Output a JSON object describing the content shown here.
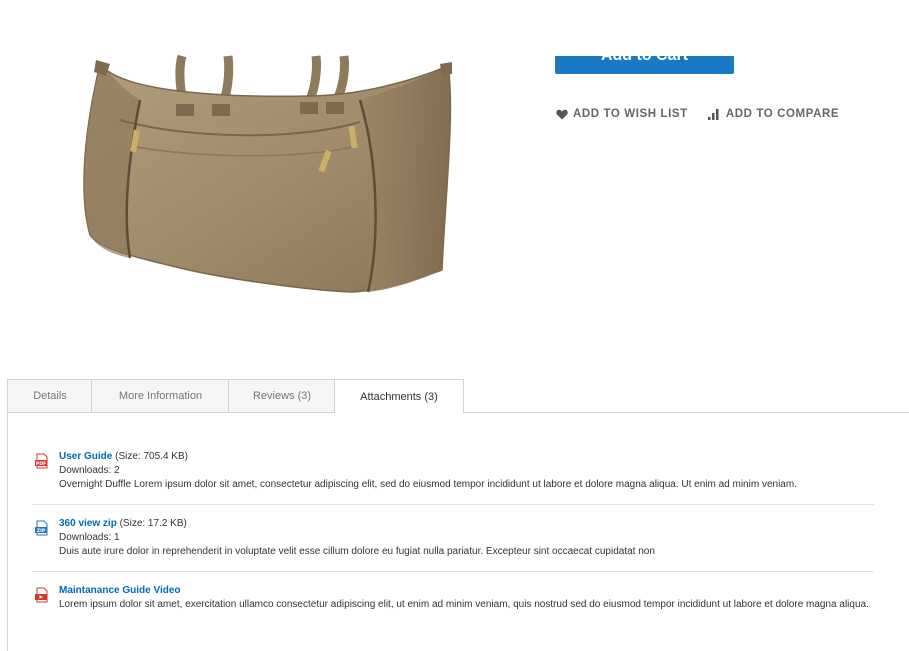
{
  "product": {
    "image_alt": "Overnight Duffle",
    "add_to_cart_label": "Add to Cart",
    "wish_list_label": "ADD TO WISH LIST",
    "compare_label": "ADD TO COMPARE"
  },
  "tabs": [
    {
      "label": "Details",
      "active": false
    },
    {
      "label": "More Information",
      "active": false
    },
    {
      "label": "Reviews (3)",
      "active": false
    },
    {
      "label": "Attachments (3)",
      "active": true
    }
  ],
  "attachments": [
    {
      "icon": "pdf-file-icon",
      "title": "User Guide",
      "size": "(Size: 705.4 KB)",
      "downloads": "Downloads: 2",
      "description": "Overnight Duffle Lorem ipsum dolor sit amet, consectetur adipiscing elit, sed do eiusmod tempor incididunt ut labore et dolore magna aliqua. Ut enim ad minim veniam."
    },
    {
      "icon": "zip-file-icon",
      "title": "360 view zip",
      "size": "(Size: 17.2 KB)",
      "downloads": "Downloads: 1",
      "description": "Duis aute irure dolor in reprehenderit in voluptate velit esse cillum dolore eu fugiat nulla pariatur. Excepteur sint occaecat cupidatat non"
    },
    {
      "icon": "video-file-icon",
      "title": "Maintanance Guide Video",
      "description": "Lorem ipsum dolor sit amet, exercitation ullamco consectetur adipiscing elit, ut enim ad minim veniam, quis nostrud sed do eiusmod tempor incididunt ut labore et dolore magna aliqua."
    }
  ],
  "colors": {
    "primary_button": "#1979c3",
    "link": "#006bb4",
    "tab_border": "#d1d1d1",
    "bag": "#a38f70"
  }
}
